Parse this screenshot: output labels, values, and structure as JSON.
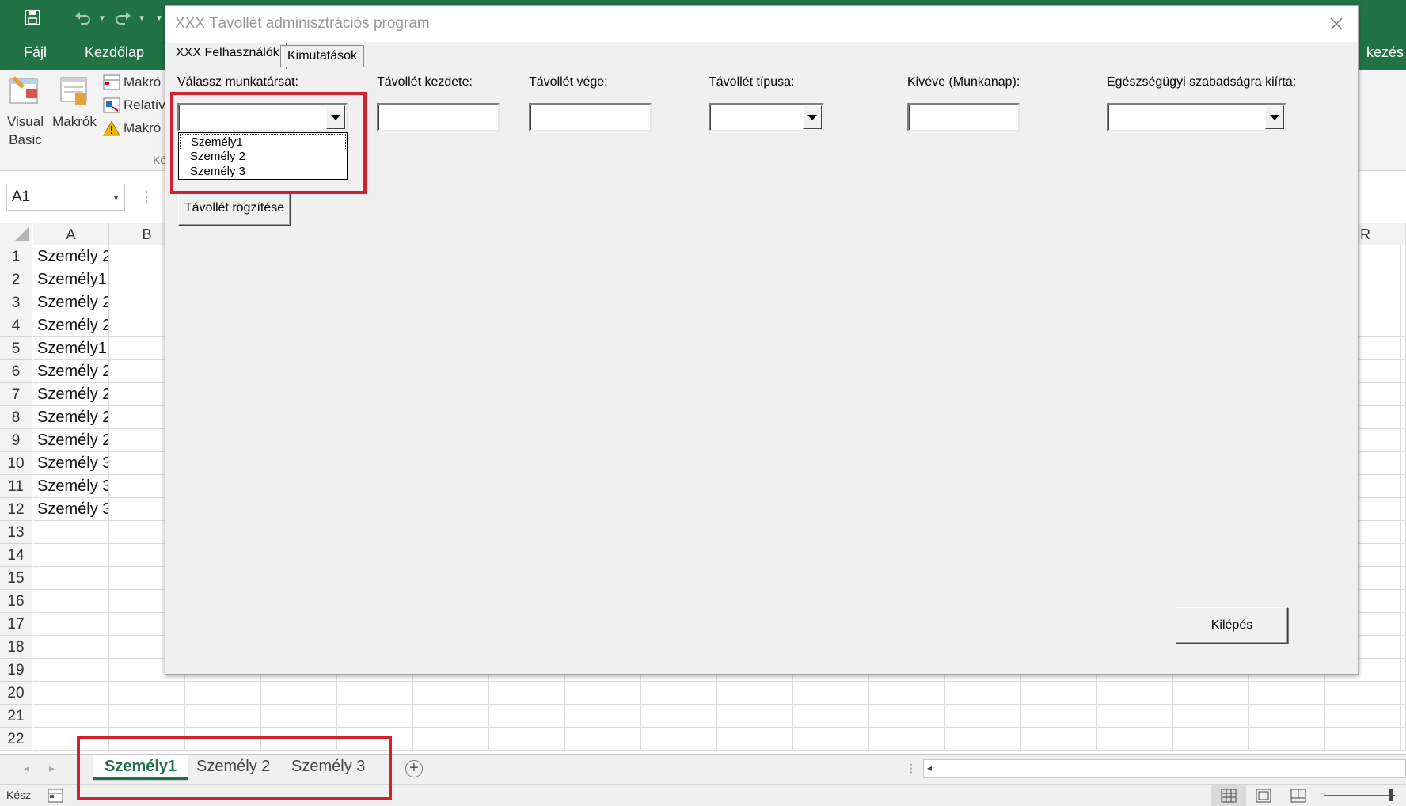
{
  "excel": {
    "ribbon_tabs": [
      "Fájl",
      "Kezdőlap",
      "kezés"
    ],
    "ribbon": {
      "visual_basic": [
        "Visual",
        "Basic"
      ],
      "macros": "Makrók",
      "small_items": [
        "Makró",
        "Relatív",
        "Makró"
      ],
      "group_label": "Kó"
    },
    "namebox": "A1",
    "columns": [
      "A",
      "B",
      "R"
    ],
    "rows": [
      "1",
      "2",
      "3",
      "4",
      "5",
      "6",
      "7",
      "8",
      "9",
      "10",
      "11",
      "12",
      "13",
      "14",
      "15",
      "16",
      "17",
      "18",
      "19",
      "20",
      "21",
      "22"
    ],
    "column_a_values": [
      "Személy 2",
      "Személy1",
      "Személy 2",
      "Személy 2",
      "Személy1",
      "Személy 2",
      "Személy 2",
      "Személy 2",
      "Személy 2",
      "Személy 3",
      "Személy 3",
      "Személy 3",
      "",
      "",
      "",
      "",
      "",
      "",
      "",
      "",
      "",
      ""
    ],
    "sheet_tabs": [
      {
        "label": "Személy1",
        "active": true
      },
      {
        "label": "Személy 2",
        "active": false
      },
      {
        "label": "Személy 3",
        "active": false
      }
    ],
    "status": "Kész",
    "colors": {
      "brand": "#217346",
      "highlight": "#d2202e"
    }
  },
  "dialog": {
    "title": "XXX Távollét adminisztrációs program",
    "tabs": [
      {
        "label": "XXX Felhasználók",
        "active": true
      },
      {
        "label": "Kimutatások",
        "active": false
      }
    ],
    "fields": {
      "employee_label": "Válassz munkatársat:",
      "start_label": "Távollét kezdete:",
      "end_label": "Távollét vége:",
      "type_label": "Távollét típusa:",
      "days_label": "Kivéve (Munkanap):",
      "sick_label": "Egészségügyi szabadságra kiírta:"
    },
    "employee_options": [
      "Személy1",
      "Személy 2",
      "Személy 3"
    ],
    "record_button": "Távollét rögzítése",
    "exit_button": "Kilépés"
  }
}
